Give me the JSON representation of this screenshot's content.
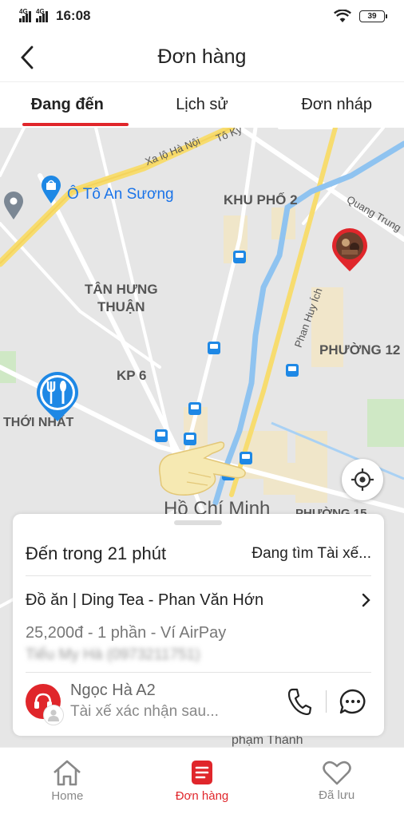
{
  "status_bar": {
    "network_1": "4G",
    "network_2": "4G",
    "time": "16:08",
    "battery": "39",
    "icons": [
      "signal-icon",
      "wifi-icon",
      "battery-icon"
    ]
  },
  "header": {
    "title": "Đơn hàng",
    "back_icon": "chevron-left-icon"
  },
  "tabs": [
    {
      "label": "Đang đến",
      "active": true
    },
    {
      "label": "Lịch sử",
      "active": false
    },
    {
      "label": "Đơn nháp",
      "active": false
    }
  ],
  "map": {
    "labels": {
      "road_xa_lo": "Xa lộ Hà Nội",
      "to_ky": "Tô Ký",
      "o_to": "Ô Tô An Sương",
      "khu_pho": "KHU PHỐ 2",
      "quang_trung": "Quang Trung",
      "tan_hung": "TÂN HƯNG\nTHUẬN",
      "phan_huy_ich": "Phan Huy Ích",
      "phuong_12": "PHƯỜNG 12",
      "kp6": "KP 6",
      "thoi_nhat": "THỚI NHẤT",
      "hcm": "Hồ Chí Minh",
      "phuong_15": "PHƯỜNG 15",
      "pham_thanh": "phạm Thành"
    },
    "colors": {
      "accent": "#e0262b",
      "river": "#8fc3f0",
      "highway": "#f7dc6f",
      "poi_blue": "#1e88e5"
    }
  },
  "order_card": {
    "eta": "Đến trong 21 phút",
    "status": "Đang tìm Tài xế...",
    "store": "Đồ ăn | Ding Tea - Phan Văn Hớn",
    "payment": "25,200đ - 1 phần - Ví AirPay",
    "customer": "Tiểu My Hà (0973211751)",
    "driver_name": "Ngọc Hà A2",
    "driver_status": "Tài xế xác nhận sau..."
  },
  "bottom_nav": [
    {
      "label": "Home",
      "icon": "home-icon",
      "active": false
    },
    {
      "label": "Đơn hàng",
      "icon": "orders-icon",
      "active": true
    },
    {
      "label": "Đã lưu",
      "icon": "heart-icon",
      "active": false
    }
  ]
}
